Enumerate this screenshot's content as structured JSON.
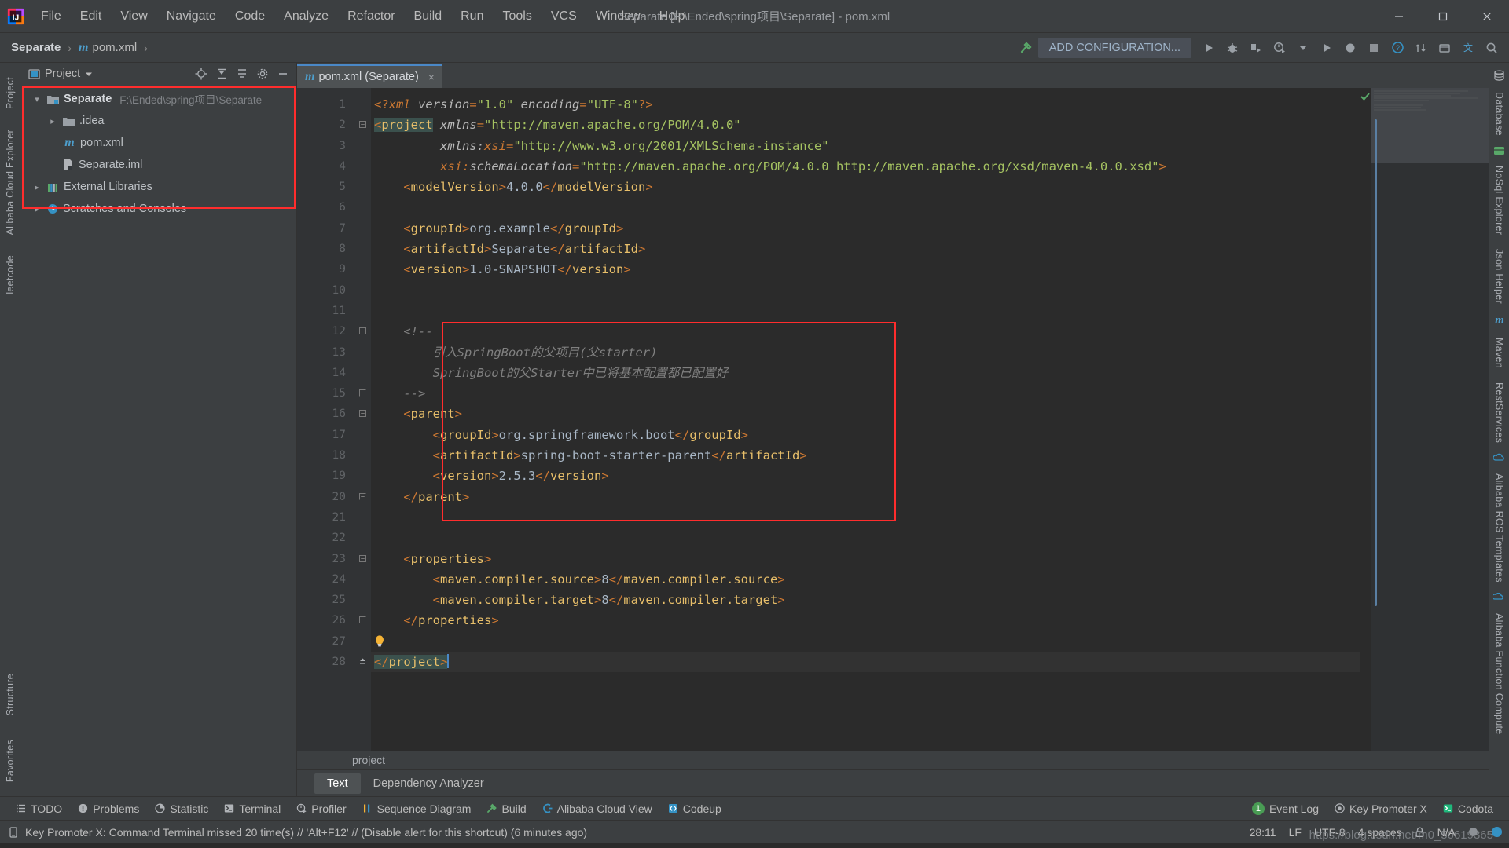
{
  "window": {
    "title": "Separate [F:\\Ended\\spring项目\\Separate] - pom.xml",
    "minimize": "−",
    "maximize": "□",
    "close": "✕"
  },
  "menubar": [
    {
      "label": "File"
    },
    {
      "label": "Edit"
    },
    {
      "label": "View"
    },
    {
      "label": "Navigate"
    },
    {
      "label": "Code"
    },
    {
      "label": "Analyze"
    },
    {
      "label": "Refactor"
    },
    {
      "label": "Build"
    },
    {
      "label": "Run"
    },
    {
      "label": "Tools"
    },
    {
      "label": "VCS"
    },
    {
      "label": "Window"
    },
    {
      "label": "Help"
    }
  ],
  "navbar": {
    "crumb_project": "Separate",
    "crumb_sep1": "›",
    "crumb_file_icon": "m",
    "crumb_file": "pom.xml",
    "crumb_sep2": "›",
    "add_configuration": "ADD CONFIGURATION..."
  },
  "left_strip": [
    {
      "label": "Project",
      "name": "tool-project"
    },
    {
      "label": "Alibaba Cloud Explorer",
      "name": "tool-alibaba-cloud-explorer"
    },
    {
      "label": "leetcode",
      "name": "tool-leetcode"
    }
  ],
  "left_strip_bottom": [
    {
      "label": "Structure",
      "name": "tool-structure"
    },
    {
      "label": "Favorites",
      "name": "tool-favorites"
    }
  ],
  "right_strip": [
    {
      "label": "Database",
      "name": "tool-database"
    },
    {
      "label": "NoSql Explorer",
      "name": "tool-nosql-explorer"
    },
    {
      "label": "Json Helper",
      "name": "tool-json-helper"
    },
    {
      "label": "Maven",
      "name": "tool-maven"
    },
    {
      "label": "RestServices",
      "name": "tool-restservices"
    },
    {
      "label": "Alibaba ROS Templates",
      "name": "tool-alibaba-ros-templates"
    },
    {
      "label": "Alibaba Function Compute",
      "name": "tool-alibaba-function-compute"
    }
  ],
  "project_panel": {
    "title": "Project",
    "tree": [
      {
        "indent": 0,
        "arrow": "v",
        "icon": "module",
        "label": "Separate",
        "bold": true,
        "path": "F:\\Ended\\spring项目\\Separate"
      },
      {
        "indent": 1,
        "arrow": ">",
        "icon": "folder",
        "label": ".idea",
        "bold": false,
        "path": ""
      },
      {
        "indent": 2,
        "arrow": "",
        "icon": "maven",
        "label": "pom.xml",
        "bold": false,
        "path": ""
      },
      {
        "indent": 2,
        "arrow": "",
        "icon": "iml",
        "label": "Separate.iml",
        "bold": false,
        "path": ""
      },
      {
        "indent": 0,
        "arrow": ">",
        "icon": "libs",
        "label": "External Libraries",
        "bold": false,
        "path": ""
      },
      {
        "indent": 0,
        "arrow": ">",
        "icon": "scratch",
        "label": "Scratches and Consoles",
        "bold": false,
        "path": ""
      }
    ]
  },
  "editor": {
    "tab_label": "pom.xml (Separate)",
    "tab_icon": "m",
    "tab_close": "×",
    "breadcrumb": "project",
    "bottom_tabs": [
      {
        "label": "Text",
        "active": true
      },
      {
        "label": "Dependency Analyzer",
        "active": false
      }
    ],
    "lines": [
      {
        "n": 1,
        "fold": "",
        "html": "<span class=\"brk\">&lt;?</span><span class=\"ns\">xml </span><span class=\"attr\">version</span><span class=\"brk\">=</span><span class=\"str\">\"1.0\"</span><span class=\"attr\"> encoding</span><span class=\"brk\">=</span><span class=\"str\">\"UTF-8\"</span><span class=\"brk\">?&gt;</span>"
      },
      {
        "n": 2,
        "fold": "-",
        "html": "<span class=\"hl-tag\"><span class=\"brk\">&lt;</span><span class=\"tagname\">project</span></span> <span class=\"attr\">xmlns</span><span class=\"brk\">=</span><span class=\"str\">\"http://maven.apache.org/POM/4.0.0\"</span>"
      },
      {
        "n": 3,
        "fold": "",
        "html": "         <span class=\"attr\">xmlns:</span><span class=\"ns\">xsi</span><span class=\"brk\">=</span><span class=\"str\">\"http://www.w3.org/2001/XMLSchema-instance\"</span>"
      },
      {
        "n": 4,
        "fold": "",
        "html": "         <span class=\"ns\">xsi:</span><span class=\"attr\">schemaLocation</span><span class=\"brk\">=</span><span class=\"str\">\"http://maven.apache.org/POM/4.0.0 http://maven.apache.org/xsd/maven-4.0.0.xsd\"</span><span class=\"brk\">&gt;</span>"
      },
      {
        "n": 5,
        "fold": "",
        "html": "    <span class=\"brk\">&lt;</span><span class=\"tagname\">modelVersion</span><span class=\"brk\">&gt;</span><span class=\"txt\">4.0.0</span><span class=\"brk\">&lt;/</span><span class=\"tagname\">modelVersion</span><span class=\"brk\">&gt;</span>"
      },
      {
        "n": 6,
        "fold": "",
        "html": ""
      },
      {
        "n": 7,
        "fold": "",
        "html": "    <span class=\"brk\">&lt;</span><span class=\"tagname\">groupId</span><span class=\"brk\">&gt;</span><span class=\"txt\">org.example</span><span class=\"brk\">&lt;/</span><span class=\"tagname\">groupId</span><span class=\"brk\">&gt;</span>"
      },
      {
        "n": 8,
        "fold": "",
        "html": "    <span class=\"brk\">&lt;</span><span class=\"tagname\">artifactId</span><span class=\"brk\">&gt;</span><span class=\"txt\">Separate</span><span class=\"brk\">&lt;/</span><span class=\"tagname\">artifactId</span><span class=\"brk\">&gt;</span>"
      },
      {
        "n": 9,
        "fold": "",
        "html": "    <span class=\"brk\">&lt;</span><span class=\"tagname\">version</span><span class=\"brk\">&gt;</span><span class=\"txt\">1.0-SNAPSHOT</span><span class=\"brk\">&lt;/</span><span class=\"tagname\">version</span><span class=\"brk\">&gt;</span>"
      },
      {
        "n": 10,
        "fold": "",
        "html": ""
      },
      {
        "n": 11,
        "fold": "",
        "html": ""
      },
      {
        "n": 12,
        "fold": "-",
        "html": "    <span class=\"cmt\">&lt;!--</span>"
      },
      {
        "n": 13,
        "fold": "",
        "html": "        <span class=\"cmt\">引入SpringBoot的父项目(父starter)</span>"
      },
      {
        "n": 14,
        "fold": "",
        "html": "        <span class=\"cmt\">SpringBoot的父Starter中已将基本配置都已配置好</span>"
      },
      {
        "n": 15,
        "fold": "+",
        "html": "    <span class=\"cmt\">--&gt;</span>"
      },
      {
        "n": 16,
        "fold": "-",
        "html": "    <span class=\"brk\">&lt;</span><span class=\"tagname\">parent</span><span class=\"brk\">&gt;</span>"
      },
      {
        "n": 17,
        "fold": "",
        "html": "        <span class=\"brk\">&lt;</span><span class=\"tagname\">groupId</span><span class=\"brk\">&gt;</span><span class=\"txt\">org.springframework.boot</span><span class=\"brk\">&lt;/</span><span class=\"tagname\">groupId</span><span class=\"brk\">&gt;</span>"
      },
      {
        "n": 18,
        "fold": "",
        "html": "        <span class=\"brk\">&lt;</span><span class=\"tagname\">artifactId</span><span class=\"brk\">&gt;</span><span class=\"txt\">spring-boot-starter-parent</span><span class=\"brk\">&lt;/</span><span class=\"tagname\">artifactId</span><span class=\"brk\">&gt;</span>"
      },
      {
        "n": 19,
        "fold": "",
        "html": "        <span class=\"brk\">&lt;</span><span class=\"tagname\">version</span><span class=\"brk\">&gt;</span><span class=\"txt\">2.5.3</span><span class=\"brk\">&lt;/</span><span class=\"tagname\">version</span><span class=\"brk\">&gt;</span>"
      },
      {
        "n": 20,
        "fold": "+",
        "html": "    <span class=\"brk\">&lt;/</span><span class=\"tagname\">parent</span><span class=\"brk\">&gt;</span>"
      },
      {
        "n": 21,
        "fold": "",
        "html": ""
      },
      {
        "n": 22,
        "fold": "",
        "html": ""
      },
      {
        "n": 23,
        "fold": "-",
        "html": "    <span class=\"brk\">&lt;</span><span class=\"tagname\">properties</span><span class=\"brk\">&gt;</span>"
      },
      {
        "n": 24,
        "fold": "",
        "html": "        <span class=\"brk\">&lt;</span><span class=\"tagname\">maven.compiler.source</span><span class=\"brk\">&gt;</span><span class=\"txt\">8</span><span class=\"brk\">&lt;/</span><span class=\"tagname\">maven.compiler.source</span><span class=\"brk\">&gt;</span>"
      },
      {
        "n": 25,
        "fold": "",
        "html": "        <span class=\"brk\">&lt;</span><span class=\"tagname\">maven.compiler.target</span><span class=\"brk\">&gt;</span><span class=\"txt\">8</span><span class=\"brk\">&lt;/</span><span class=\"tagname\">maven.compiler.target</span><span class=\"brk\">&gt;</span>"
      },
      {
        "n": 26,
        "fold": "+",
        "html": "    <span class=\"brk\">&lt;/</span><span class=\"tagname\">properties</span><span class=\"brk\">&gt;</span>"
      },
      {
        "n": 27,
        "fold": "",
        "html": ""
      },
      {
        "n": 28,
        "fold": "^",
        "html": "<span class=\"hl-tag\"><span class=\"brk\">&lt;/</span><span class=\"tagname\">project</span><span class=\"brk\">&gt;</span></span>",
        "current": true
      }
    ]
  },
  "toolwindow_bar": {
    "left": [
      {
        "label": "TODO",
        "icon": "todo-icon"
      },
      {
        "label": "Problems",
        "icon": "problems-icon"
      },
      {
        "label": "Statistic",
        "icon": "statistic-icon"
      },
      {
        "label": "Terminal",
        "icon": "terminal-icon"
      },
      {
        "label": "Profiler",
        "icon": "profiler-icon"
      },
      {
        "label": "Sequence Diagram",
        "icon": "sequence-diagram-icon"
      },
      {
        "label": "Build",
        "icon": "build-icon"
      },
      {
        "label": "Alibaba Cloud View",
        "icon": "alibaba-cloud-icon"
      },
      {
        "label": "Codeup",
        "icon": "codeup-icon"
      }
    ],
    "right": [
      {
        "label": "Event Log",
        "badge": "1"
      },
      {
        "label": "Key Promoter X",
        "badge": ""
      },
      {
        "label": "Codota",
        "badge": ""
      }
    ]
  },
  "statusbar": {
    "message": "Key Promoter X: Command Terminal missed 20 time(s) // 'Alt+F12' // (Disable alert for this shortcut) (6 minutes ago)",
    "caret": "28:11",
    "line_sep": "LF",
    "encoding": "UTF-8",
    "indent": "4 spaces",
    "branch": "N/A",
    "watermark": "https://blog.csdn.net/m0_50619365"
  },
  "colors": {
    "accent_blue": "#4a88c7",
    "highlight_red": "#ff2d2d",
    "green": "#499c54",
    "maven_blue": "#4d9ecc",
    "bg_panel": "#3c3f41",
    "bg_editor": "#2b2b2b",
    "bg_gutter": "#313335"
  }
}
